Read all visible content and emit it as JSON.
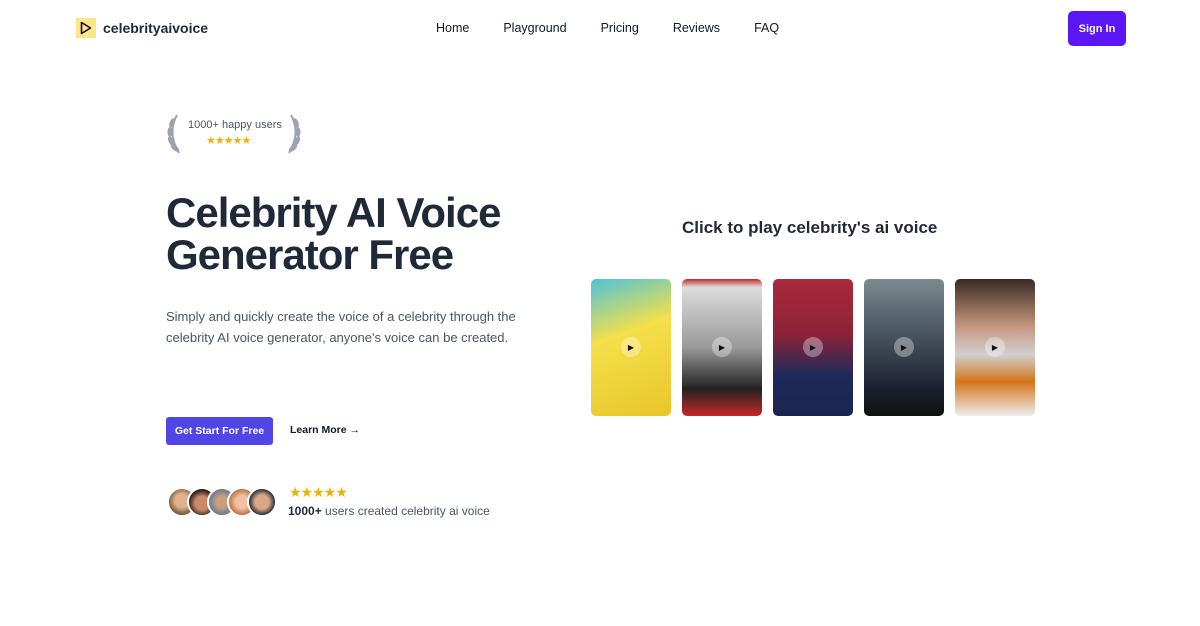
{
  "nav": {
    "brand": "celebrityaivoice",
    "items": [
      "Home",
      "Playground",
      "Pricing",
      "Reviews",
      "FAQ"
    ],
    "sign_in": "Sign In"
  },
  "hero": {
    "badge_text": "1000+ happy users",
    "badge_stars": "★★★★★",
    "title": "Celebrity AI Voice Generator Free",
    "description": "Simply and quickly create the voice of a celebrity through the celebrity AI voice generator, anyone's voice can be created.",
    "cta": "Get Start For Free",
    "learn_more": "Learn More →",
    "rating_stars": "★★★★★",
    "users_count": "1000+",
    "users_text": " users created celebrity ai voice"
  },
  "showcase": {
    "title": "Click to play celebrity's ai voice",
    "cards": [
      {
        "bg": "linear-gradient(160deg,#4fc3d9 0%,#f5e04a 40%,#e8c52a 100%)"
      },
      {
        "bg": "linear-gradient(180deg,#c62828 0%,#ddd 6%,#999 50%,#222 80%,#c62828 100%)"
      },
      {
        "bg": "linear-gradient(180deg,#a82a3a 0%,#8e2236 40%,#1e2a5a 70%,#1a2450 100%)"
      },
      {
        "bg": "linear-gradient(180deg,#7a8a90 0%,#4a5560 40%,#1b2030 80%,#111 100%)"
      },
      {
        "bg": "linear-gradient(180deg,#3a2a20 0%,#c59880 35%,#d0d0d0 55%,#d4751a 75%,#eee 100%)"
      }
    ]
  },
  "colors": {
    "accent": "#4f46e5",
    "signin": "#5b16f5",
    "star": "#eab308"
  }
}
